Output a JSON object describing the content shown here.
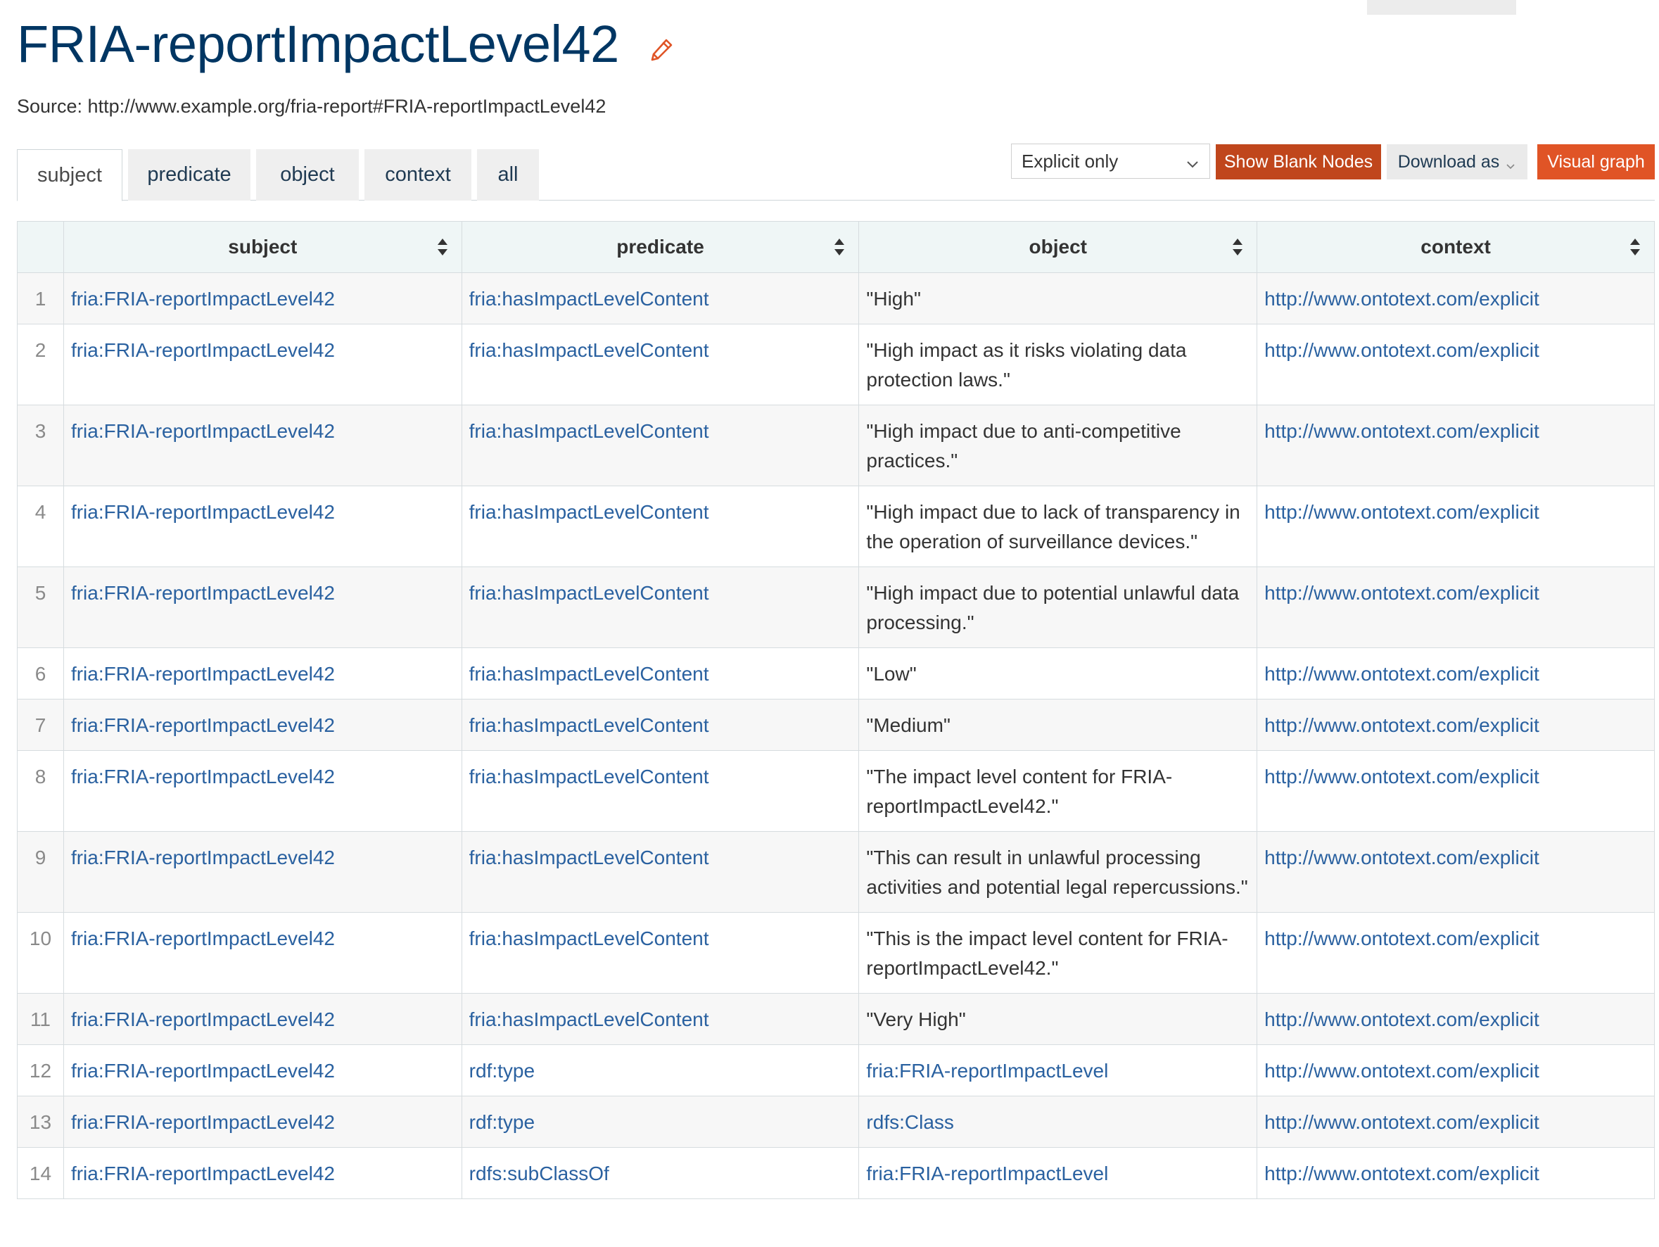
{
  "header": {
    "title": "FRIA-reportImpactLevel42",
    "source_label": "Source: http://www.example.org/fria-report#FRIA-reportImpactLevel42"
  },
  "tabs": [
    {
      "label": "subject",
      "active": true
    },
    {
      "label": "predicate",
      "active": false
    },
    {
      "label": "object",
      "active": false
    },
    {
      "label": "context",
      "active": false
    },
    {
      "label": "all",
      "active": false
    }
  ],
  "toolbar": {
    "filter_selected": "Explicit only",
    "show_blank_nodes_label": "Show Blank Nodes",
    "download_label": "Download as",
    "visual_graph_label": "Visual graph"
  },
  "table": {
    "columns": [
      "subject",
      "predicate",
      "object",
      "context"
    ],
    "rows": [
      {
        "num": "1",
        "subject": "fria:FRIA-reportImpactLevel42",
        "predicate": "fria:hasImpactLevelContent",
        "object": "\"High\"",
        "object_is_link": false,
        "context": "http://www.ontotext.com/explicit"
      },
      {
        "num": "2",
        "subject": "fria:FRIA-reportImpactLevel42",
        "predicate": "fria:hasImpactLevelContent",
        "object": "\"High impact as it risks violating data protection laws.\"",
        "object_is_link": false,
        "context": "http://www.ontotext.com/explicit"
      },
      {
        "num": "3",
        "subject": "fria:FRIA-reportImpactLevel42",
        "predicate": "fria:hasImpactLevelContent",
        "object": "\"High impact due to anti-competitive practices.\"",
        "object_is_link": false,
        "context": "http://www.ontotext.com/explicit"
      },
      {
        "num": "4",
        "subject": "fria:FRIA-reportImpactLevel42",
        "predicate": "fria:hasImpactLevelContent",
        "object": "\"High impact due to lack of transparency in the operation of surveillance devices.\"",
        "object_is_link": false,
        "context": "http://www.ontotext.com/explicit"
      },
      {
        "num": "5",
        "subject": "fria:FRIA-reportImpactLevel42",
        "predicate": "fria:hasImpactLevelContent",
        "object": "\"High impact due to potential unlawful data processing.\"",
        "object_is_link": false,
        "context": "http://www.ontotext.com/explicit"
      },
      {
        "num": "6",
        "subject": "fria:FRIA-reportImpactLevel42",
        "predicate": "fria:hasImpactLevelContent",
        "object": "\"Low\"",
        "object_is_link": false,
        "context": "http://www.ontotext.com/explicit"
      },
      {
        "num": "7",
        "subject": "fria:FRIA-reportImpactLevel42",
        "predicate": "fria:hasImpactLevelContent",
        "object": "\"Medium\"",
        "object_is_link": false,
        "context": "http://www.ontotext.com/explicit"
      },
      {
        "num": "8",
        "subject": "fria:FRIA-reportImpactLevel42",
        "predicate": "fria:hasImpactLevelContent",
        "object": "\"The impact level content for FRIA-reportImpactLevel42.\"",
        "object_is_link": false,
        "context": "http://www.ontotext.com/explicit"
      },
      {
        "num": "9",
        "subject": "fria:FRIA-reportImpactLevel42",
        "predicate": "fria:hasImpactLevelContent",
        "object": "\"This can result in unlawful processing activities and potential legal repercussions.\"",
        "object_is_link": false,
        "context": "http://www.ontotext.com/explicit"
      },
      {
        "num": "10",
        "subject": "fria:FRIA-reportImpactLevel42",
        "predicate": "fria:hasImpactLevelContent",
        "object": "\"This is the impact level content for FRIA-reportImpactLevel42.\"",
        "object_is_link": false,
        "context": "http://www.ontotext.com/explicit"
      },
      {
        "num": "11",
        "subject": "fria:FRIA-reportImpactLevel42",
        "predicate": "fria:hasImpactLevelContent",
        "object": "\"Very High\"",
        "object_is_link": false,
        "context": "http://www.ontotext.com/explicit"
      },
      {
        "num": "12",
        "subject": "fria:FRIA-reportImpactLevel42",
        "predicate": "rdf:type",
        "object": "fria:FRIA-reportImpactLevel",
        "object_is_link": true,
        "context": "http://www.ontotext.com/explicit"
      },
      {
        "num": "13",
        "subject": "fria:FRIA-reportImpactLevel42",
        "predicate": "rdf:type",
        "object": "rdfs:Class",
        "object_is_link": true,
        "context": "http://www.ontotext.com/explicit"
      },
      {
        "num": "14",
        "subject": "fria:FRIA-reportImpactLevel42",
        "predicate": "rdfs:subClassOf",
        "object": "fria:FRIA-reportImpactLevel",
        "object_is_link": true,
        "context": "http://www.ontotext.com/explicit"
      }
    ]
  },
  "colors": {
    "title": "#003663",
    "link": "#2a61a0",
    "accent_dark": "#c0461c",
    "accent": "#e05426",
    "header_bg": "#eff6f6"
  },
  "icons": {
    "edit": "pencil-icon",
    "sort": "sort-icon",
    "dropdown": "chevron-down-icon"
  }
}
